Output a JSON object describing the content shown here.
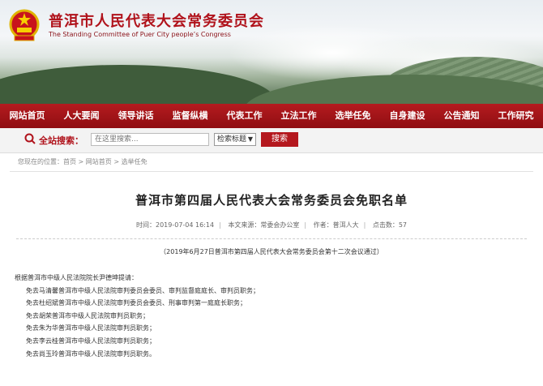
{
  "header": {
    "title_cn": "普洱市人民代表大会常务委员会",
    "title_en": "The Standing Committee of Puer City people’s Congress",
    "colors": {
      "brand_red": "#b0121b",
      "nav_red": "#a3161a"
    }
  },
  "nav": {
    "items": [
      "网站首页",
      "人大要闻",
      "领导讲话",
      "监督纵横",
      "代表工作",
      "立法工作",
      "选举任免",
      "自身建设",
      "公告通知",
      "工作研究"
    ]
  },
  "search": {
    "label": "全站搜索：",
    "placeholder": "在这里搜索...",
    "select_value": "检索标题",
    "button": "搜索",
    "icon": "search-icon"
  },
  "breadcrumb": "您现在的位置：首页 > 网站首页 > 选举任免",
  "article": {
    "title": "普洱市第四届人民代表大会常务委员会免职名单",
    "meta": {
      "time": "时间：2019-07-04 16:14",
      "source": "本文来源：常委会办公室",
      "author": "作者：普洱人大",
      "clicks": "点击数：57"
    },
    "note": "（2019年6月27日普洱市第四届人民代表大会常务委员会第十二次会议通过）",
    "lines": [
      "根据普洱市中级人民法院院长尹德坤提请：",
      "免去马清馨普洱市中级人民法院审判委员会委员、审判监督庭庭长、审判员职务；",
      "免去杜绍斌普洱市中级人民法院审判委员会委员、刑事审判第一庭庭长职务；",
      "免去胡荣普洱市中级人民法院审判员职务；",
      "免去朱为华普洱市中级人民法院审判员职务；",
      "免去李云桂普洱市中级人民法院审判员职务；",
      "免去尚玉玲普洱市中级人民法院审判员职务。"
    ]
  }
}
